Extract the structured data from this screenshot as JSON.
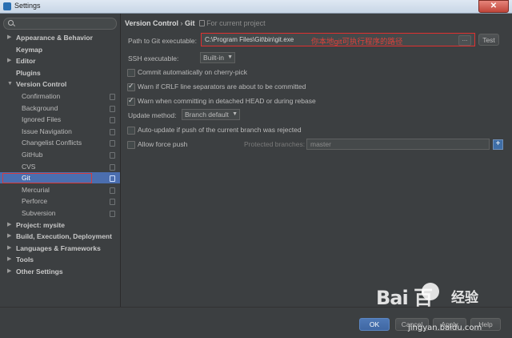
{
  "window": {
    "title": "Settings",
    "close_symbol": "✕"
  },
  "search": {
    "placeholder": ""
  },
  "sidebar": {
    "items": [
      {
        "label": "Appearance & Behavior",
        "level": 0,
        "arrow": "▶"
      },
      {
        "label": "Keymap",
        "level": 0,
        "arrow": ""
      },
      {
        "label": "Editor",
        "level": 0,
        "arrow": "▶"
      },
      {
        "label": "Plugins",
        "level": 0,
        "arrow": ""
      },
      {
        "label": "Version Control",
        "level": 0,
        "arrow": "▼"
      },
      {
        "label": "Confirmation",
        "level": 1
      },
      {
        "label": "Background",
        "level": 1
      },
      {
        "label": "Ignored Files",
        "level": 1
      },
      {
        "label": "Issue Navigation",
        "level": 1
      },
      {
        "label": "Changelist Conflicts",
        "level": 1
      },
      {
        "label": "GitHub",
        "level": 1
      },
      {
        "label": "CVS",
        "level": 1
      },
      {
        "label": "Git",
        "level": 1,
        "selected": true
      },
      {
        "label": "Mercurial",
        "level": 1
      },
      {
        "label": "Perforce",
        "level": 1
      },
      {
        "label": "Subversion",
        "level": 1
      },
      {
        "label": "Project: mysite",
        "level": 0,
        "arrow": "▶"
      },
      {
        "label": "Build, Execution, Deployment",
        "level": 0,
        "arrow": "▶"
      },
      {
        "label": "Languages & Frameworks",
        "level": 0,
        "arrow": "▶"
      },
      {
        "label": "Tools",
        "level": 0,
        "arrow": "▶"
      },
      {
        "label": "Other Settings",
        "level": 0,
        "arrow": "▶"
      }
    ]
  },
  "breadcrumb": {
    "section": "Version Control",
    "separator": "›",
    "page": "Git",
    "scope": "For current project"
  },
  "git": {
    "path_label": "Path to Git executable:",
    "path_value": "C:\\Program Files\\Git\\bin\\git.exe",
    "path_annotation": "你本地git可执行程序的路径",
    "browse_label": "...",
    "test_button": "Test",
    "ssh_label": "SSH executable:",
    "ssh_value": "Built-in",
    "commit_cherry_pick": "Commit automatically on cherry-pick",
    "commit_cherry_pick_checked": false,
    "warn_crlf": "Warn if CRLF line separators are about to be committed",
    "warn_crlf_checked": true,
    "warn_detached": "Warn when committing in detached HEAD or during rebase",
    "warn_detached_checked": true,
    "update_method_label": "Update method:",
    "update_method_value": "Branch default",
    "auto_update": "Auto-update if push of the current branch was rejected",
    "auto_update_checked": false,
    "allow_force_push": "Allow force push",
    "allow_force_push_checked": false,
    "protected_branches_label": "Protected branches:",
    "protected_branches_value": "master",
    "add_symbol": "+"
  },
  "footer": {
    "ok": "OK",
    "cancel": "Cancel",
    "apply": "Apply",
    "help": "Help"
  },
  "watermark": {
    "logo": "Bai  百",
    "brand_cn": "经验",
    "url": "jingyan.baidu.com"
  },
  "colors": {
    "selection": "#4b6eaf",
    "highlight_border": "#e03030",
    "annotation": "#e0413b"
  }
}
